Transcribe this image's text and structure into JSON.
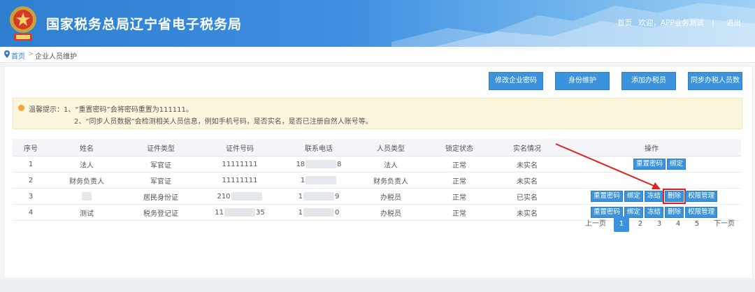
{
  "header": {
    "title": "国家税务总局辽宁省电子税务局",
    "nav": {
      "home": "首页",
      "welcome": "欢迎，APP业务测试",
      "sep": "|",
      "logout": "退出"
    }
  },
  "breadcrumb": {
    "home": "首页",
    "arrow": ">",
    "current": "企业人员维护"
  },
  "actions": {
    "modify_password": "修改企业密码",
    "identity_maintain": "身份维护",
    "add_taxpayer": "添加办税员",
    "sync_taxpayers": "同步办税人员数"
  },
  "tip": {
    "line1": "温馨提示：1、“重置密码”会将密码重置为111111。",
    "line2": "2、“同步人员数据”会检测相关人员信息，例如手机号码，是否实名，是否已注册自然人账号等。"
  },
  "table": {
    "headers": [
      "序号",
      "姓名",
      "证件类型",
      "证件号码",
      "联系电话",
      "人员类型",
      "锁定状态",
      "实名情况",
      "操作"
    ],
    "rows": [
      {
        "no": "1",
        "name": "法人",
        "idtype": "军官证",
        "idno": "11111111",
        "phone_a": "18",
        "phone_b": "8",
        "ptype": "法人",
        "lock": "正常",
        "realname": "未实名"
      },
      {
        "no": "2",
        "name": "财务负责人",
        "idtype": "军官证",
        "idno": "11111111",
        "phone_a": "1",
        "phone_b": "",
        "ptype": "财务负责人",
        "lock": "正常",
        "realname": "未实名"
      },
      {
        "no": "3",
        "name": "",
        "idtype": "居民身份证",
        "idno": "210",
        "phone_a": "1",
        "phone_b": "9",
        "ptype": "办税员",
        "lock": "正常",
        "realname": "已实名"
      },
      {
        "no": "4",
        "name": "测试",
        "idtype": "税务登记证",
        "idno": "11",
        "idno_b": "35",
        "phone_a": "1",
        "phone_b": "0",
        "ptype": "办税员",
        "lock": "正常",
        "realname": "未实名"
      }
    ],
    "ops": {
      "reset": "重置密码",
      "bind": "绑定",
      "freeze": "冻结",
      "delete": "删除",
      "perm": "权限管理"
    }
  },
  "pager": {
    "prev": "上一页",
    "pages": [
      "1",
      "2",
      "3",
      "4",
      "5"
    ],
    "next": "下一页",
    "current": "1"
  },
  "colors": {
    "accent": "#3a93dc",
    "tip_bg": "#fcf6dc",
    "highlight": "#e02020"
  },
  "icons": {
    "emblem": "tax-emblem",
    "location": "location-pin-icon"
  }
}
